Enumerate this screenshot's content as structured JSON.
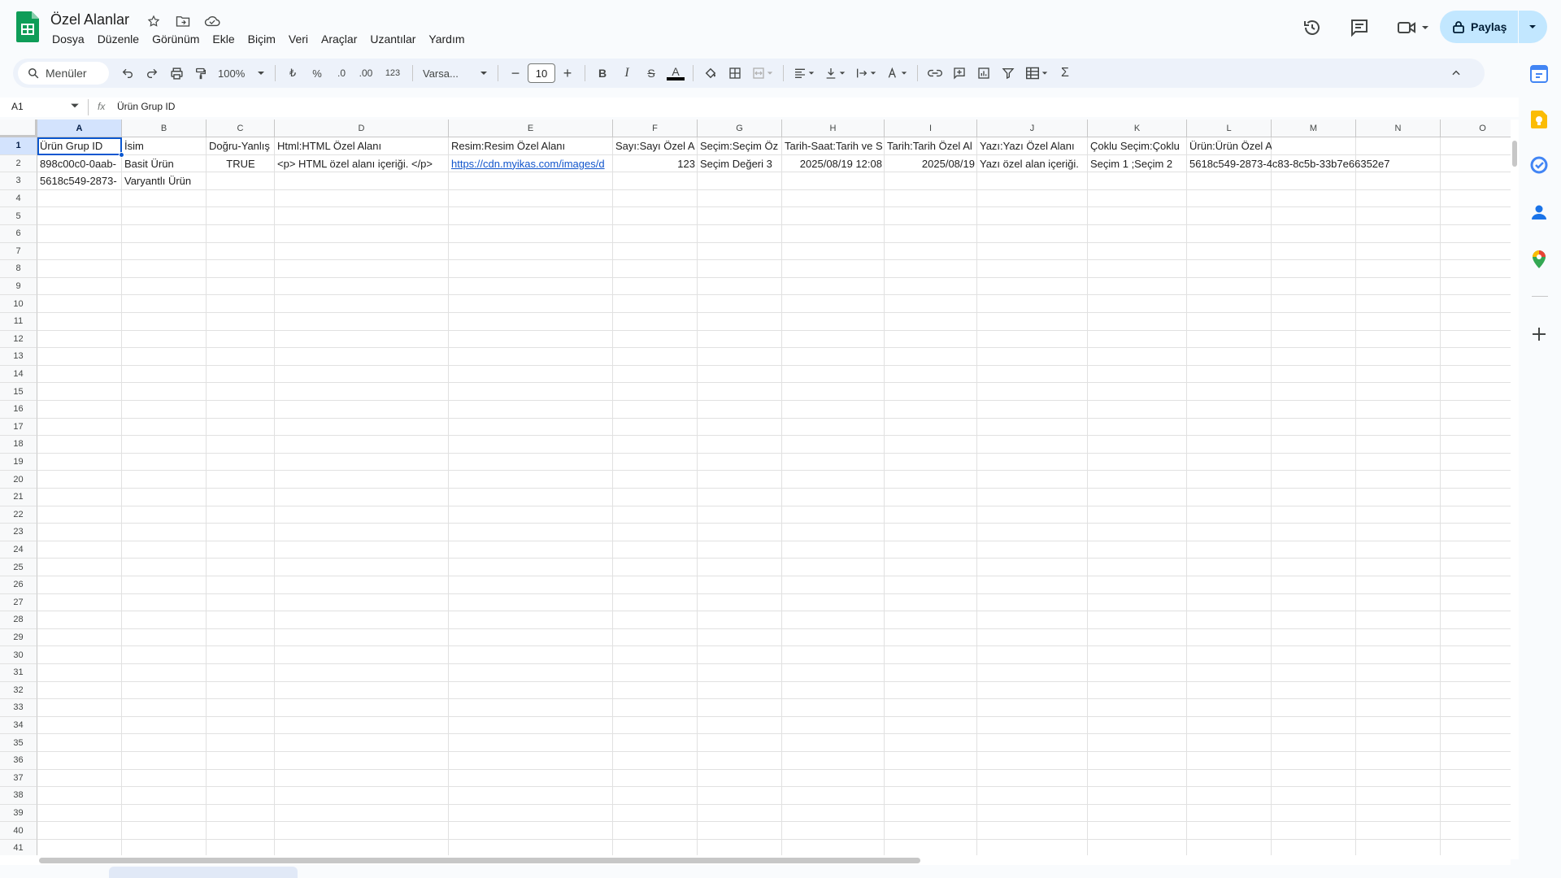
{
  "app": {
    "title": "Özel Alanlar",
    "menu": [
      "Dosya",
      "Düzenle",
      "Görünüm",
      "Ekle",
      "Biçim",
      "Veri",
      "Araçlar",
      "Uzantılar",
      "Yardım"
    ],
    "share_label": "Paylaş"
  },
  "toolbar": {
    "search_label": "Menüler",
    "zoom": "100%",
    "currency": "₺",
    "percent": "%",
    "dec_decrease": ".0",
    "dec_increase": ".00",
    "number_format": "123",
    "font": "Varsa...",
    "font_size": "10",
    "bold": "B",
    "italic": "I",
    "strike": "S",
    "text_color": "A",
    "sum": "Σ"
  },
  "formula_bar": {
    "name_box": "A1",
    "fx": "fx",
    "value": "Ürün Grup ID"
  },
  "grid": {
    "columns": [
      "A",
      "B",
      "C",
      "D",
      "E",
      "F",
      "G",
      "H",
      "I",
      "J",
      "K",
      "L",
      "M",
      "N",
      "O"
    ],
    "row_numbers": [
      "1",
      "2",
      "3",
      "4",
      "5",
      "6",
      "7",
      "8",
      "9",
      "10",
      "11",
      "12",
      "13",
      "14",
      "15",
      "16",
      "17",
      "18",
      "19",
      "20",
      "21",
      "22",
      "23",
      "24",
      "25",
      "26",
      "27",
      "28",
      "29",
      "30",
      "31",
      "32",
      "33",
      "34",
      "35",
      "36",
      "37",
      "38",
      "39",
      "40",
      "41"
    ],
    "rows": [
      [
        "Ürün Grup ID",
        "İsim",
        "Doğru-Yanlış",
        "Html:HTML Özel Alanı",
        "Resim:Resim Özel Alanı",
        "Sayı:Sayı Özel A",
        "Seçim:Seçim Öz",
        "Tarih-Saat:Tarih ve S",
        "Tarih:Tarih Özel Al",
        "Yazı:Yazı Özel Alanı",
        "Çoklu Seçim:Çoklu",
        "Ürün:Ürün Özel Alanı",
        "",
        "",
        ""
      ],
      [
        "898c00c0-0aab-",
        "Basit Ürün",
        "TRUE",
        "<p> HTML özel alanı içeriği. </p>",
        "https://cdn.myikas.com/images/d",
        "123",
        "Seçim Değeri 3",
        "2025/08/19 12:08",
        "2025/08/19",
        "Yazı özel alan içeriği.",
        "Seçim 1 ;Seçim 2",
        "5618c549-2873-4c83-8c5b-33b7e66352e7",
        "",
        "",
        ""
      ],
      [
        "5618c549-2873-",
        "Varyantlı Ürün",
        "",
        "",
        "",
        "",
        "",
        "",
        "",
        "",
        "",
        "",
        "",
        "",
        ""
      ]
    ]
  },
  "colors": {
    "accent": "#0b57d0",
    "selected_header": "#d3e3fd",
    "share_bg": "#c2e7ff",
    "link": "#1155cc",
    "sheets_green": "#0f9d58"
  },
  "icons": [
    "sheets-logo-icon",
    "star-icon",
    "move-folder-icon",
    "cloud-icon",
    "history-icon",
    "comments-icon",
    "meet-icon",
    "lock-icon",
    "search-icon",
    "undo-icon",
    "redo-icon",
    "print-icon",
    "paint-format-icon",
    "fill-color-icon",
    "borders-icon",
    "merge-icon",
    "align-icon",
    "valign-icon",
    "wrap-icon",
    "rotate-icon",
    "link-icon",
    "comment-add-icon",
    "chart-icon",
    "filter-icon",
    "table-icon",
    "calendar-icon",
    "keep-icon",
    "tasks-icon",
    "contacts-icon",
    "maps-icon",
    "plus-icon"
  ]
}
